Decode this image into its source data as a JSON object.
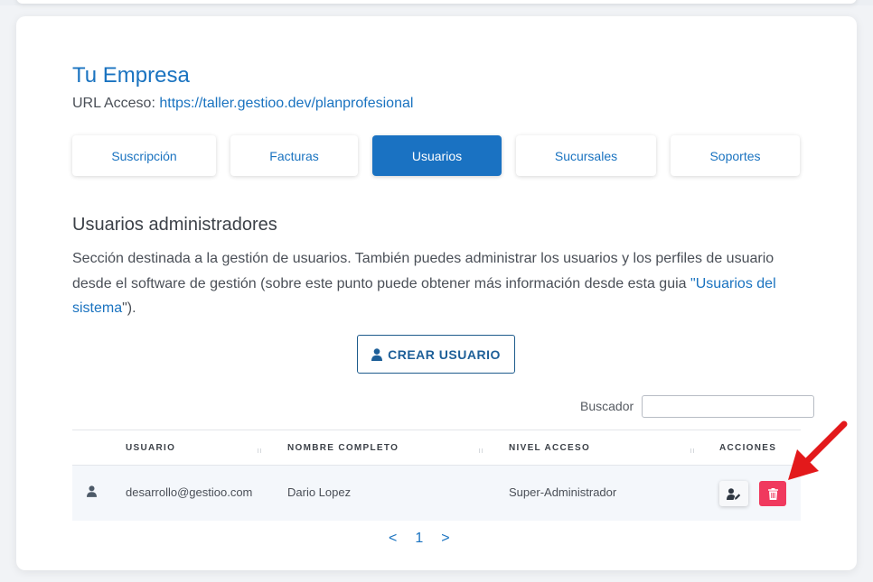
{
  "company": {
    "name": "Tu Empresa",
    "access_label": "URL Acceso:",
    "access_url": "https://taller.gestioo.dev/planprofesional"
  },
  "tabs": [
    {
      "label": "Suscripción",
      "active": false
    },
    {
      "label": "Facturas",
      "active": false
    },
    {
      "label": "Usuarios",
      "active": true
    },
    {
      "label": "Sucursales",
      "active": false
    },
    {
      "label": "Soportes",
      "active": false
    }
  ],
  "section": {
    "title": "Usuarios administradores",
    "desc_text": "Sección destinada a la gestión de usuarios. También puedes administrar los usuarios y los perfiles de usuario desde el software de gestión (sobre este punto puede obtener más información desde esta guia ",
    "desc_quote_open": "\"",
    "desc_link": "Usuarios del sistema",
    "desc_end": "\")."
  },
  "create_button": {
    "label": "CREAR USUARIO",
    "icon": "user-icon"
  },
  "search": {
    "label": "Buscador",
    "value": "",
    "placeholder": ""
  },
  "table": {
    "headers": [
      "USUARIO",
      "NOMBRE COMPLETO",
      "NIVEL ACCESO",
      "ACCIONES"
    ],
    "rows": [
      {
        "icon": "user-icon",
        "usuario": "desarrollo@gestioo.com",
        "nombre": "Dario Lopez",
        "nivel": "Super-Administrador",
        "actions": [
          "user-edit-icon",
          "trash-icon"
        ]
      }
    ]
  },
  "pagination": {
    "prev": "<",
    "current": "1",
    "next": ">"
  },
  "colors": {
    "accent": "#1a72c2",
    "delete": "#f0395e",
    "annotation_arrow": "#e3191b"
  }
}
